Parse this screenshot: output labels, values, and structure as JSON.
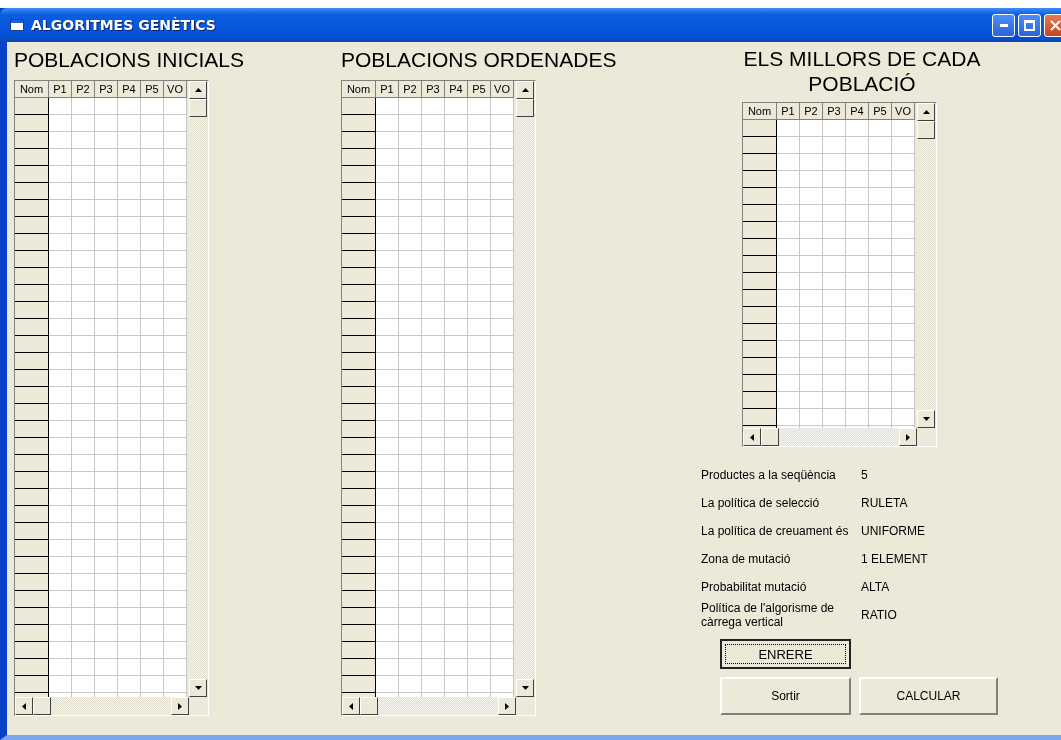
{
  "window": {
    "title": "ALGORITMES GENÈTICS"
  },
  "grids": [
    {
      "heading": "POBLACIONS INICIALS",
      "columns": [
        "Nom",
        "P1",
        "P2",
        "P3",
        "P4",
        "P5",
        "VO"
      ]
    },
    {
      "heading": "POBLACIONS ORDENADES",
      "columns": [
        "Nom",
        "P1",
        "P2",
        "P3",
        "P4",
        "P5",
        "VO"
      ]
    },
    {
      "heading": "ELS MILLORS DE CADA POBLACIÓ",
      "columns": [
        "Nom",
        "P1",
        "P2",
        "P3",
        "P4",
        "P5",
        "VO"
      ]
    }
  ],
  "settings": [
    {
      "label": "Productes a la seqüència",
      "value": "5"
    },
    {
      "label": "La política de selecció",
      "value": "RULETA"
    },
    {
      "label": "La política de creuament és",
      "value": "UNIFORME"
    },
    {
      "label": "Zona de mutació",
      "value": "1 ELEMENT"
    },
    {
      "label": "Probabilitat mutació",
      "value": "ALTA"
    },
    {
      "label": "Política de l'algorisme de càrrega vertical",
      "value": "RATIO"
    }
  ],
  "button_rows": [
    [
      {
        "label": "ENRERE",
        "focused": true
      }
    ],
    [
      {
        "label": "Sortir",
        "focused": false
      },
      {
        "label": "CALCULAR",
        "focused": false
      }
    ]
  ]
}
